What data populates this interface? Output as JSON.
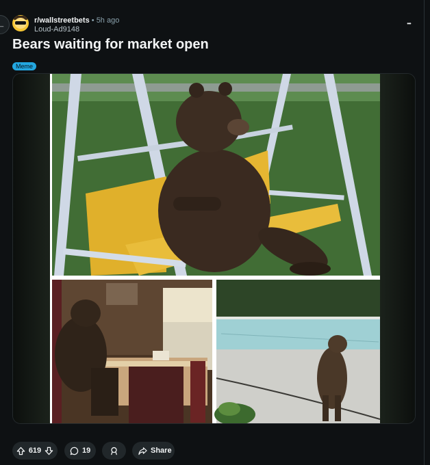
{
  "nav": {
    "back_icon": "arrow-left-icon"
  },
  "post": {
    "subreddit": "r/wallstreetbets",
    "separator": "•",
    "time": "5h ago",
    "author": "Loud-Ad9148",
    "title": "Bears waiting for market open",
    "flair": "Meme",
    "more_label": "•••"
  },
  "media": {
    "images": [
      "bear-on-swing-photo",
      "bear-at-kitchen-table-photo",
      "bear-in-empty-pool-photo"
    ]
  },
  "actions": {
    "upvotes": "619",
    "comments": "19",
    "share_label": "Share"
  },
  "colors": {
    "background": "#0e1113",
    "pill": "#21272a",
    "flair": "#23a7e0"
  }
}
